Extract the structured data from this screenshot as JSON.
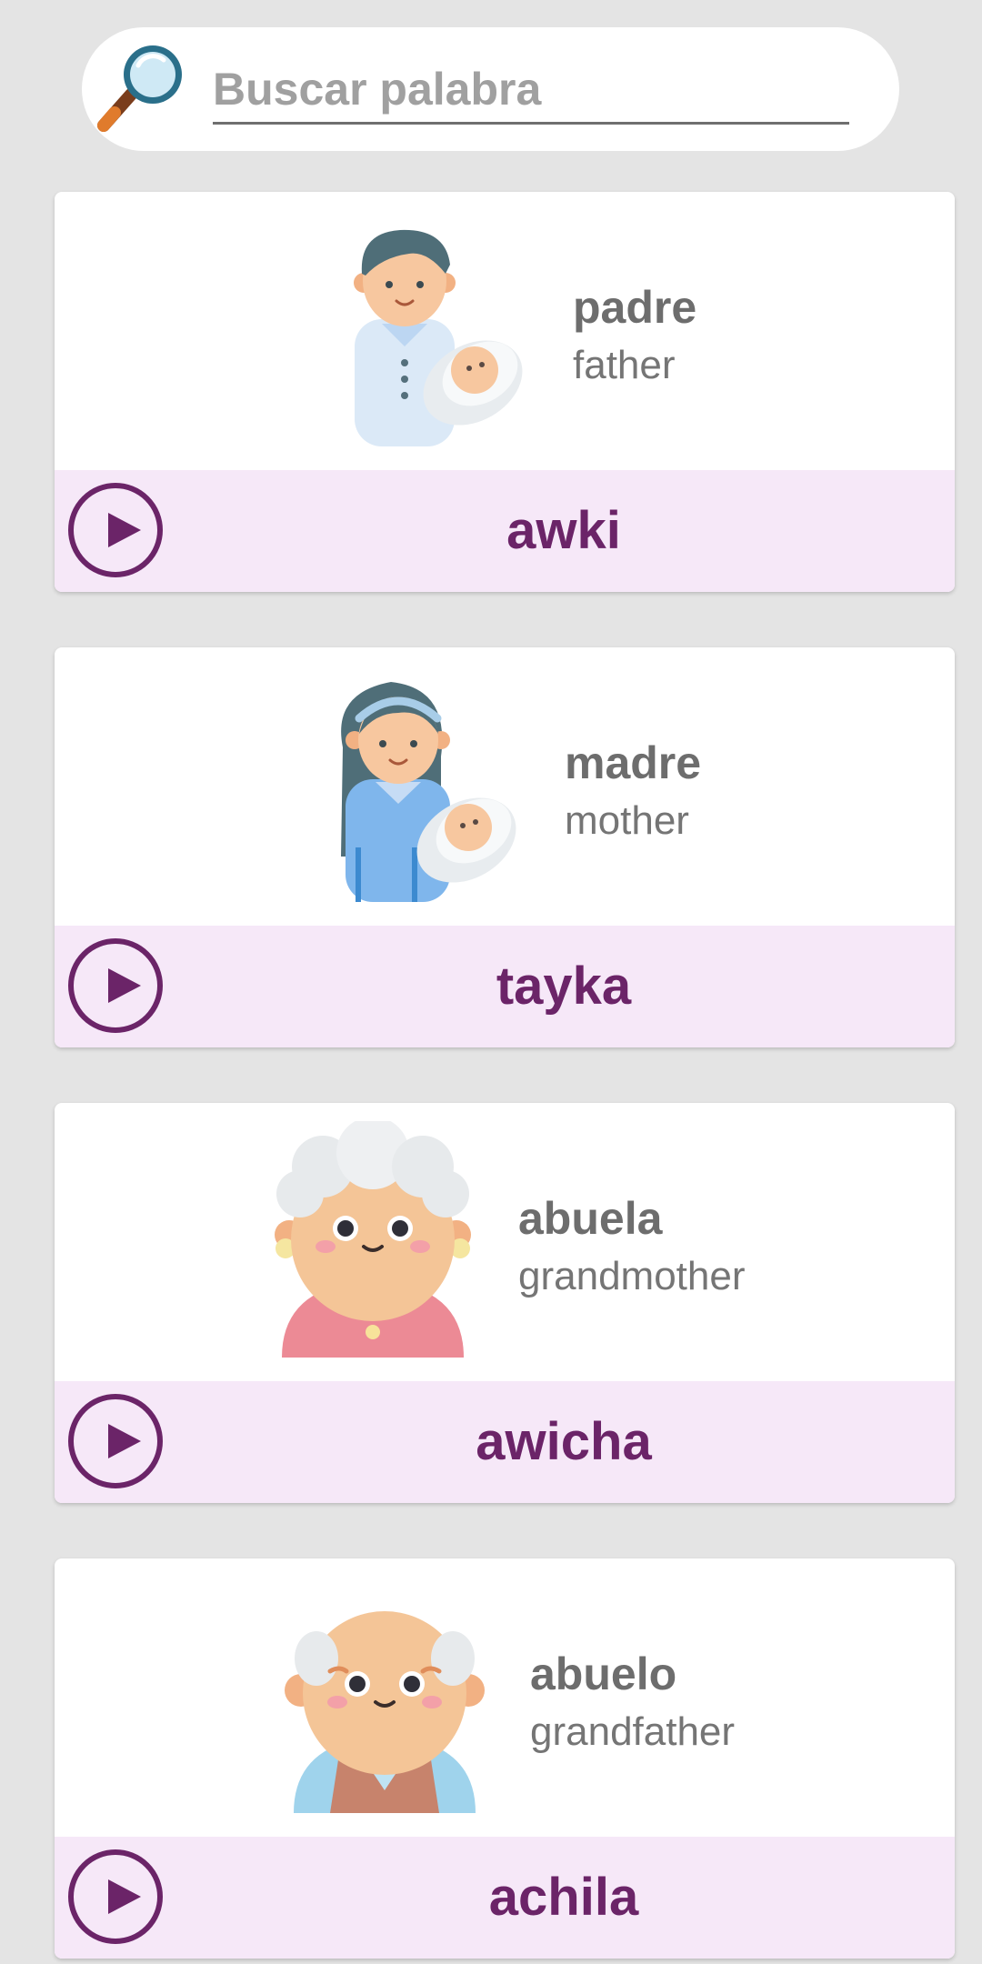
{
  "search": {
    "placeholder": "Buscar palabra"
  },
  "icons": {
    "search": "magnifier-icon",
    "play": "play-icon"
  },
  "colors": {
    "accent": "#6b2468",
    "bar_background": "#f6e8f8",
    "page_background": "#e4e4e4"
  },
  "words": [
    {
      "spanish": "padre",
      "english": "father",
      "quechua": "awki",
      "image": "father-with-baby-illustration"
    },
    {
      "spanish": "madre",
      "english": "mother",
      "quechua": "tayka",
      "image": "mother-with-baby-illustration"
    },
    {
      "spanish": "abuela",
      "english": "grandmother",
      "quechua": "awicha",
      "image": "grandmother-illustration"
    },
    {
      "spanish": "abuelo",
      "english": "grandfather",
      "quechua": "achila",
      "image": "grandfather-illustration"
    }
  ]
}
